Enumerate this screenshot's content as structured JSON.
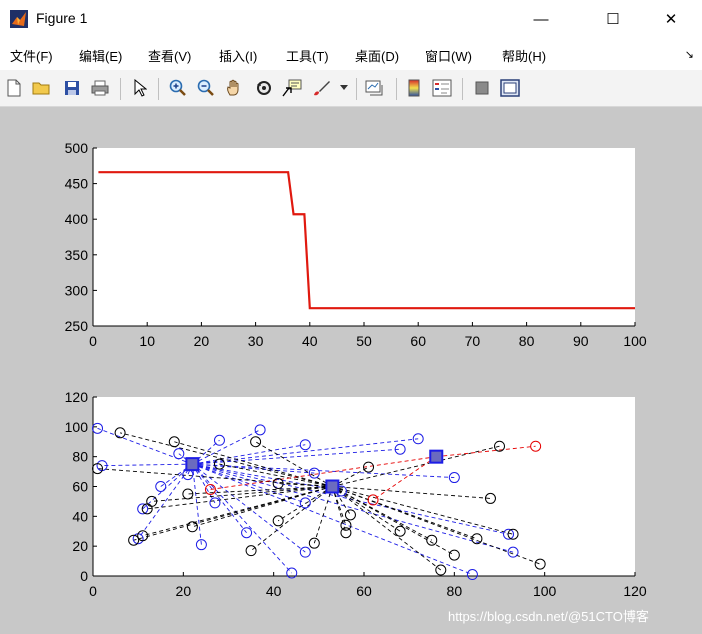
{
  "window": {
    "title": "Figure 1",
    "minimize": "—",
    "maximize": "☐",
    "close": "✕"
  },
  "menu": [
    "文件(F)",
    "编辑(E)",
    "查看(V)",
    "插入(I)",
    "工具(T)",
    "桌面(D)",
    "窗口(W)",
    "帮助(H)"
  ],
  "watermark": "https://blog.csdn.net/@51CTO博客",
  "colors": {
    "line": "#e0190f",
    "blue": "#1d1de6",
    "red": "#e60000",
    "black": "#000000",
    "marker_fill": "#6b6bbf"
  },
  "chart_data": [
    {
      "type": "line",
      "xlim": [
        0,
        100
      ],
      "ylim": [
        250,
        500
      ],
      "xticks": [
        "0",
        "10",
        "20",
        "30",
        "40",
        "50",
        "60",
        "70",
        "80",
        "90",
        "100"
      ],
      "yticks": [
        "250",
        "300",
        "350",
        "400",
        "450",
        "500"
      ],
      "series": [
        {
          "x": [
            1,
            36,
            37,
            39,
            40,
            100
          ],
          "y": [
            466,
            466,
            407,
            407,
            275,
            275
          ]
        }
      ]
    },
    {
      "type": "scatter",
      "xlim": [
        0,
        120
      ],
      "ylim": [
        0,
        120
      ],
      "xticks": [
        "0",
        "20",
        "40",
        "60",
        "80",
        "100",
        "120"
      ],
      "yticks": [
        "0",
        "20",
        "40",
        "60",
        "80",
        "100",
        "120"
      ],
      "centers": [
        {
          "x": 22,
          "y": 75
        },
        {
          "x": 53,
          "y": 60
        },
        {
          "x": 76,
          "y": 80
        }
      ],
      "points_blue": [
        [
          1,
          99
        ],
        [
          2,
          74
        ],
        [
          11,
          45
        ],
        [
          15,
          60
        ],
        [
          19,
          82
        ],
        [
          24,
          21
        ],
        [
          28,
          91
        ],
        [
          27,
          49
        ],
        [
          37,
          98
        ],
        [
          34,
          29
        ],
        [
          44,
          2
        ],
        [
          47,
          49
        ],
        [
          47,
          16
        ],
        [
          47,
          88
        ],
        [
          49,
          69
        ],
        [
          55,
          57
        ],
        [
          68,
          85
        ],
        [
          72,
          92
        ],
        [
          80,
          66
        ],
        [
          84,
          1
        ],
        [
          92,
          28
        ],
        [
          93,
          16
        ],
        [
          10,
          25
        ],
        [
          21,
          68
        ]
      ],
      "points_black": [
        [
          1,
          72
        ],
        [
          6,
          96
        ],
        [
          9,
          24
        ],
        [
          12,
          45
        ],
        [
          13,
          50
        ],
        [
          18,
          90
        ],
        [
          22,
          33
        ],
        [
          28,
          75
        ],
        [
          35,
          17
        ],
        [
          36,
          90
        ],
        [
          41,
          37
        ],
        [
          41,
          62
        ],
        [
          49,
          22
        ],
        [
          56,
          34
        ],
        [
          56,
          29
        ],
        [
          57,
          41
        ],
        [
          61,
          73
        ],
        [
          68,
          30
        ],
        [
          75,
          24
        ],
        [
          77,
          4
        ],
        [
          80,
          14
        ],
        [
          85,
          25
        ],
        [
          88,
          52
        ],
        [
          90,
          87
        ],
        [
          93,
          28
        ],
        [
          99,
          8
        ],
        [
          11,
          27
        ],
        [
          21,
          55
        ]
      ],
      "points_red": [
        [
          26,
          58
        ],
        [
          62,
          51
        ],
        [
          98,
          87
        ]
      ]
    }
  ]
}
